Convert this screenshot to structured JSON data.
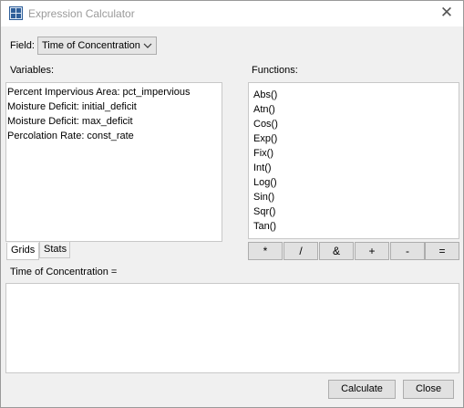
{
  "window": {
    "title": "Expression Calculator",
    "close_glyph": "✕"
  },
  "field": {
    "label": "Field:",
    "selected": "Time of Concentration"
  },
  "variables": {
    "label": "Variables:",
    "items": [
      "Percent Impervious Area: pct_impervious",
      "Moisture Deficit: initial_deficit",
      "Moisture Deficit: max_deficit",
      "Percolation Rate: const_rate"
    ]
  },
  "functions": {
    "label": "Functions:",
    "items": [
      "Abs()",
      "Atn()",
      "Cos()",
      "Exp()",
      "Fix()",
      "Int()",
      "Log()",
      "Sin()",
      "Sqr()",
      "Tan()"
    ]
  },
  "tabs": {
    "grids": "Grids",
    "stats": "Stats"
  },
  "operators": [
    "*",
    "/",
    "&",
    "+",
    "-",
    "="
  ],
  "expression": {
    "label": "Time of Concentration =",
    "value": ""
  },
  "buttons": {
    "calculate": "Calculate",
    "close": "Close"
  }
}
